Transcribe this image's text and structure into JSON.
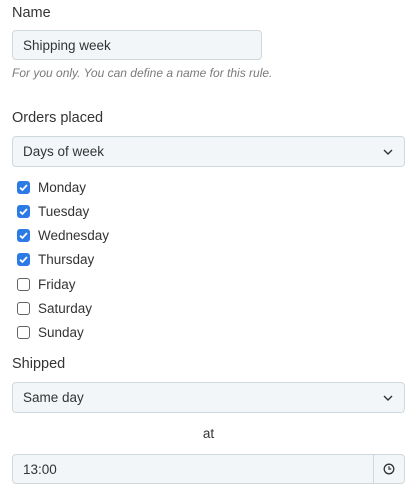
{
  "name_section": {
    "label": "Name",
    "value": "Shipping week",
    "hint": "For you only. You can define a name for this rule."
  },
  "orders_section": {
    "label": "Orders placed",
    "select_value": "Days of week",
    "days": [
      {
        "label": "Monday",
        "checked": true
      },
      {
        "label": "Tuesday",
        "checked": true
      },
      {
        "label": "Wednesday",
        "checked": true
      },
      {
        "label": "Thursday",
        "checked": true
      },
      {
        "label": "Friday",
        "checked": false
      },
      {
        "label": "Saturday",
        "checked": false
      },
      {
        "label": "Sunday",
        "checked": false
      }
    ]
  },
  "shipped_section": {
    "label": "Shipped",
    "select_value": "Same day",
    "at_label": "at",
    "time_value": "13:00"
  },
  "colors": {
    "accent": "#2c7be5",
    "field_bg": "#f3f6f8",
    "field_border": "#cfd8dc"
  },
  "icons": {
    "select_chevron": "chevron-down-icon",
    "checkbox_check": "checkmark-icon",
    "time_button": "clock-icon"
  }
}
